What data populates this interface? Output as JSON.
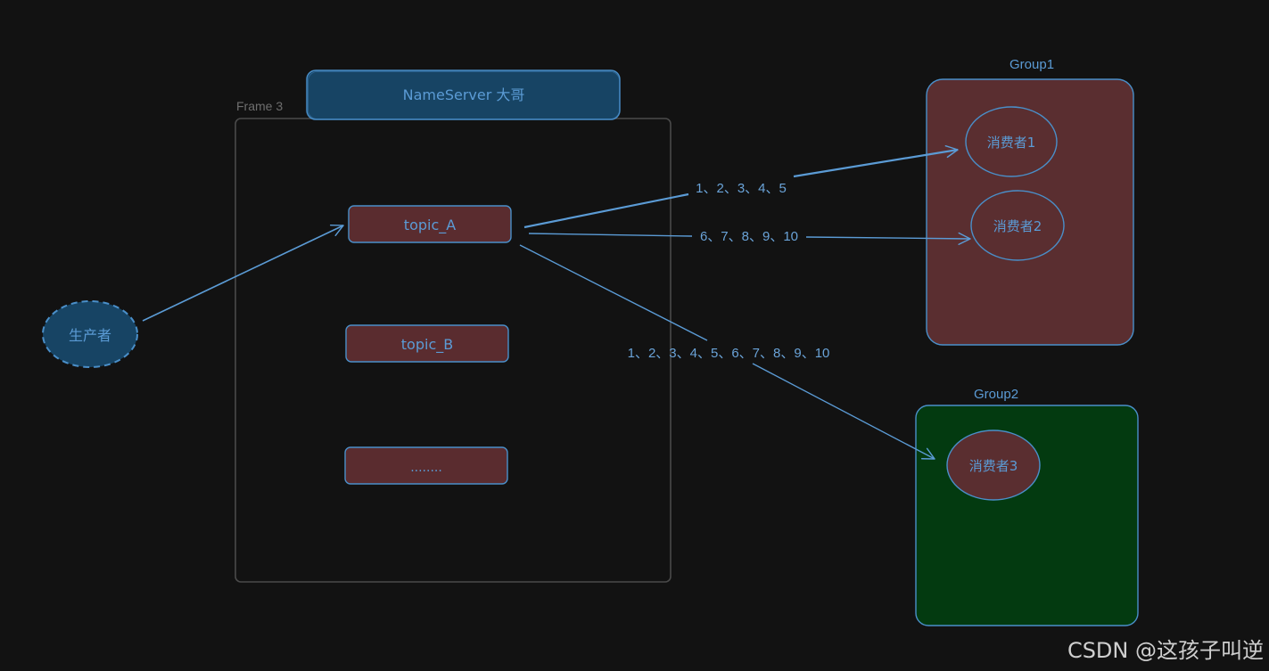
{
  "frame": {
    "label": "Frame 3"
  },
  "nameserver": {
    "label": "NameServer 大哥"
  },
  "producer": {
    "label": "生产者"
  },
  "topics": [
    {
      "label": "topic_A"
    },
    {
      "label": "topic_B"
    },
    {
      "label": "........"
    }
  ],
  "groups": [
    {
      "label": "Group1",
      "consumers": [
        {
          "label": "消费者1"
        },
        {
          "label": "消费者2"
        }
      ]
    },
    {
      "label": "Group2",
      "consumers": [
        {
          "label": "消费者3"
        }
      ]
    }
  ],
  "arrows": {
    "to_consumer1": "1、2、3、4、5",
    "to_consumer2": "6、7、8、9、10",
    "to_consumer3": "1、2、3、4、5、6、7、8、9、10"
  },
  "watermark": "CSDN @这孩子叫逆",
  "colors": {
    "background": "#121212",
    "frame_stroke": "#4a4a4a",
    "blue_fill": "#174464",
    "blue_stroke": "#4a8fc9",
    "topic_fill": "#5a2c2f",
    "group1_fill": "#5a2e30",
    "group2_fill": "#033a10",
    "text_blue": "#5b9bd5"
  }
}
